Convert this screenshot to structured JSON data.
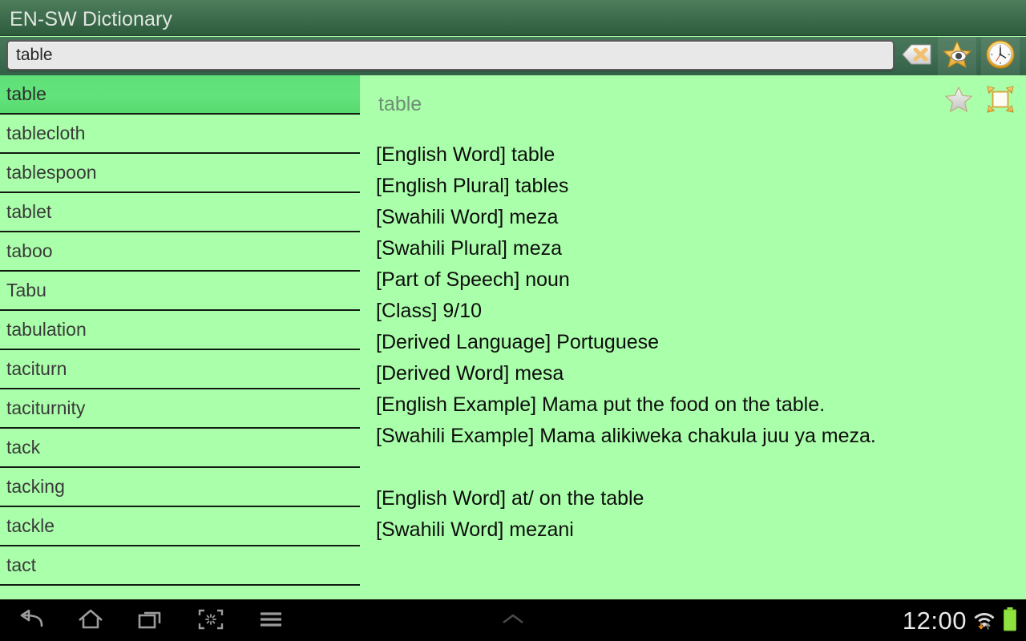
{
  "window": {
    "title": "EN-SW Dictionary"
  },
  "search": {
    "value": "table",
    "placeholder": "",
    "clear_icon": "backspace-clear-icon",
    "favorites_icon": "star-eye-icon",
    "history_icon": "clock-icon"
  },
  "word_list": {
    "selected_index": 0,
    "items": [
      {
        "label": "table"
      },
      {
        "label": "tablecloth"
      },
      {
        "label": "tablespoon"
      },
      {
        "label": "tablet"
      },
      {
        "label": "taboo"
      },
      {
        "label": "Tabu"
      },
      {
        "label": "tabulation"
      },
      {
        "label": "taciturn"
      },
      {
        "label": "taciturnity"
      },
      {
        "label": "tack"
      },
      {
        "label": "tacking"
      },
      {
        "label": "tackle"
      },
      {
        "label": "tact"
      },
      {
        "label": ""
      }
    ]
  },
  "detail": {
    "header": "table",
    "star_icon": "star-outline-icon",
    "expand_icon": "expand-fullscreen-icon",
    "entries": [
      "[English Word] table",
      "[English Plural] tables",
      "[Swahili Word] meza",
      "[Swahili Plural] meza",
      "[Part of Speech] noun",
      "[Class] 9/10",
      "[Derived Language] Portuguese",
      "[Derived Word] mesa",
      "[English Example] Mama put the food on the table.",
      "[Swahili Example] Mama alikiweka chakula juu ya meza.",
      "",
      "[English Word] at/ on the table",
      "[Swahili Word] mezani"
    ]
  },
  "navbar": {
    "back_icon": "back-arrow-icon",
    "home_icon": "home-icon",
    "recents_icon": "recent-apps-icon",
    "screenshot_icon": "screenshot-icon",
    "menu_icon": "menu-hamburger-icon",
    "notifications_icon": "chevron-up-icon",
    "time": "12:00",
    "wifi_icon": "wifi-icon",
    "battery_icon": "battery-icon"
  },
  "colors": {
    "content_bg": "#AAFFAA",
    "titlebar_top": "#4d7d5b",
    "titlebar_bottom": "#2d5c3c",
    "selected_row": "#63E07A",
    "accent_orange": "#f0b64d",
    "battery_green": "#8fe33f"
  }
}
